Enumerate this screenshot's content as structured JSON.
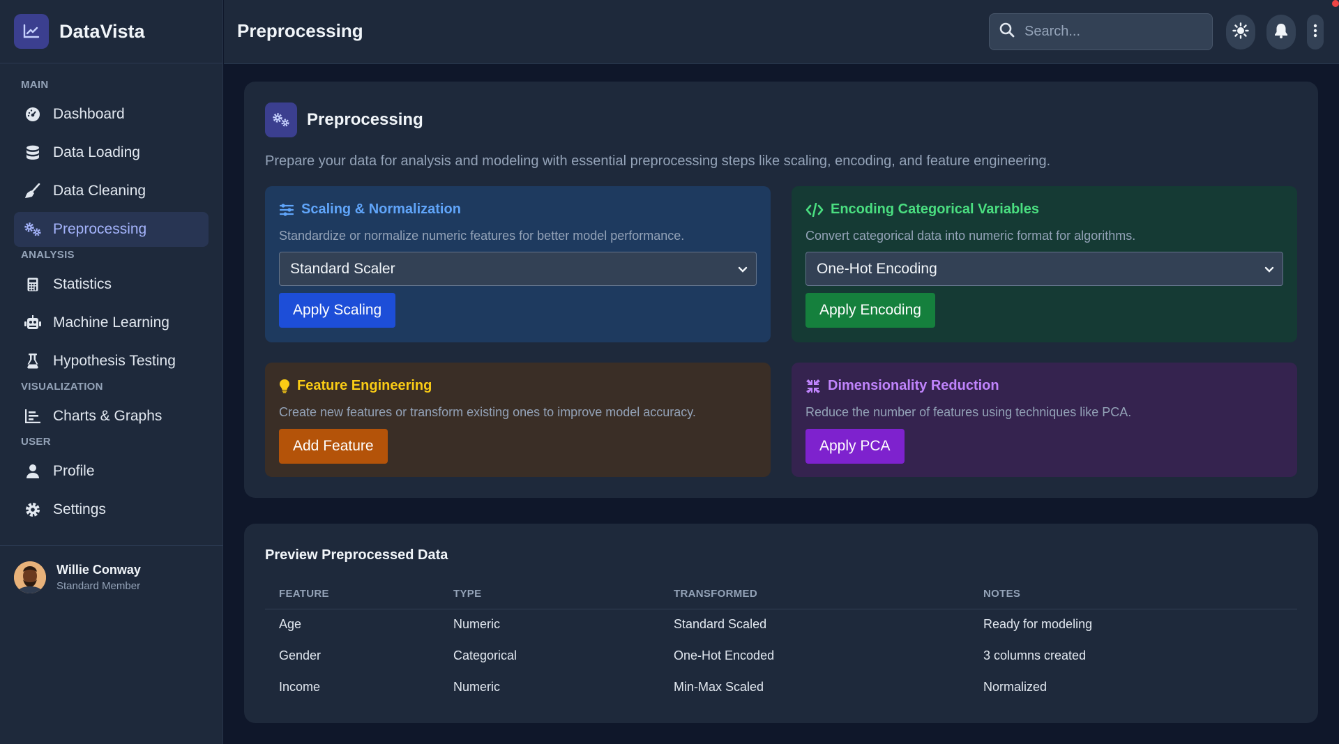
{
  "app": {
    "name": "DataVista"
  },
  "header": {
    "title": "Preprocessing",
    "search_placeholder": "Search..."
  },
  "sidebar": {
    "sections": [
      {
        "label": "MAIN",
        "items": [
          {
            "label": "Dashboard",
            "icon": "gauge-icon"
          },
          {
            "label": "Data Loading",
            "icon": "database-icon"
          },
          {
            "label": "Data Cleaning",
            "icon": "broom-icon"
          },
          {
            "label": "Preprocessing",
            "icon": "gears-icon",
            "active": true
          }
        ]
      },
      {
        "label": "ANALYSIS",
        "items": [
          {
            "label": "Statistics",
            "icon": "calculator-icon"
          },
          {
            "label": "Machine Learning",
            "icon": "robot-icon"
          },
          {
            "label": "Hypothesis Testing",
            "icon": "flask-icon"
          }
        ]
      },
      {
        "label": "VISUALIZATION",
        "items": [
          {
            "label": "Charts & Graphs",
            "icon": "chart-icon"
          }
        ]
      },
      {
        "label": "USER",
        "items": [
          {
            "label": "Profile",
            "icon": "user-icon"
          },
          {
            "label": "Settings",
            "icon": "gear-icon"
          }
        ]
      }
    ]
  },
  "user": {
    "name": "Willie Conway",
    "role": "Standard Member"
  },
  "panel": {
    "title": "Preprocessing",
    "description": "Prepare your data for analysis and modeling with essential preprocessing steps like scaling, encoding, and feature engineering."
  },
  "cards": {
    "scaling": {
      "title": "Scaling & Normalization",
      "description": "Standardize or normalize numeric features for better model performance.",
      "select_value": "Standard Scaler",
      "button": "Apply Scaling"
    },
    "encoding": {
      "title": "Encoding Categorical Variables",
      "description": "Convert categorical data into numeric format for algorithms.",
      "select_value": "One-Hot Encoding",
      "button": "Apply Encoding"
    },
    "feature": {
      "title": "Feature Engineering",
      "description": "Create new features or transform existing ones to improve model accuracy.",
      "button": "Add Feature"
    },
    "dimred": {
      "title": "Dimensionality Reduction",
      "description": "Reduce the number of features using techniques like PCA.",
      "button": "Apply PCA"
    }
  },
  "preview": {
    "title": "Preview Preprocessed Data",
    "columns": [
      "FEATURE",
      "TYPE",
      "TRANSFORMED",
      "NOTES"
    ],
    "rows": [
      [
        "Age",
        "Numeric",
        "Standard Scaled",
        "Ready for modeling"
      ],
      [
        "Gender",
        "Categorical",
        "One-Hot Encoded",
        "3 columns created"
      ],
      [
        "Income",
        "Numeric",
        "Min-Max Scaled",
        "Normalized"
      ]
    ]
  },
  "colors": {
    "accent": "#6366f1",
    "scaling": "#60a5fa",
    "encoding": "#4ade80",
    "feature": "#facc15",
    "dimred": "#c084fc"
  }
}
